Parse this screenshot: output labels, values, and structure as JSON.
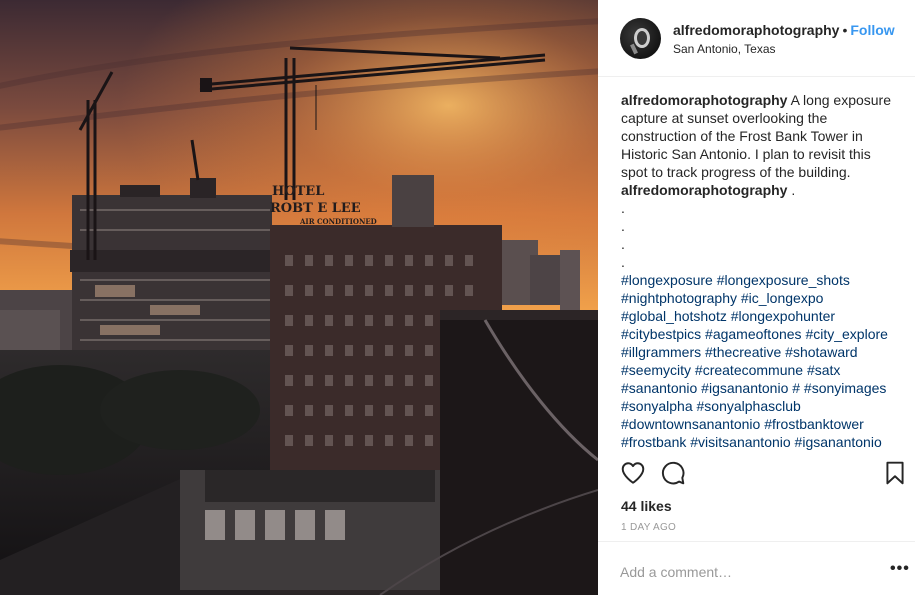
{
  "post": {
    "username": "alfredomoraphotography",
    "separator": "•",
    "follow_label": "Follow",
    "location": "San Antonio, Texas",
    "caption_text": "A long exposure capture at sunset overlooking the construction of the Frost Bank Tower in Historic San Antonio. I plan to revisit this spot to track progress of the building.",
    "comment_text": ".",
    "dot_lines": [
      ".",
      ".",
      ".",
      "."
    ],
    "hashtag_lines": [
      "#longexposure #longexposure_shots",
      "#nightphotography #ic_longexpo",
      "#global_hotshotz #longexpohunter",
      "#citybestpics #agameoftones #city_explore",
      "#illgrammers #thecreative #shotaward",
      "#seemycity #createcommune #satx",
      "#sanantonio #igsanantonio # #sonyimages",
      "#sonyalpha #sonyalphasclub",
      "#downtownsanantonio #frostbanktower",
      "#frostbank #visitsanantonio #igsanantonio"
    ],
    "likes": "44 likes",
    "time_ago": "1 DAY AGO",
    "comment_placeholder": "Add a comment…",
    "more_label": "•••"
  },
  "photo": {
    "sign_line1": "HOTEL",
    "sign_line2": "ROBT E LEE",
    "sign_line3": "AIR CONDITIONED"
  },
  "colors": {
    "link_blue": "#3897f0",
    "hashtag": "#003569",
    "meta_gray": "#999999",
    "divider": "#efefef"
  },
  "icons": {
    "like": "heart-icon",
    "comment": "comment-bubble-icon",
    "save": "bookmark-icon",
    "more": "more-dots-icon"
  }
}
